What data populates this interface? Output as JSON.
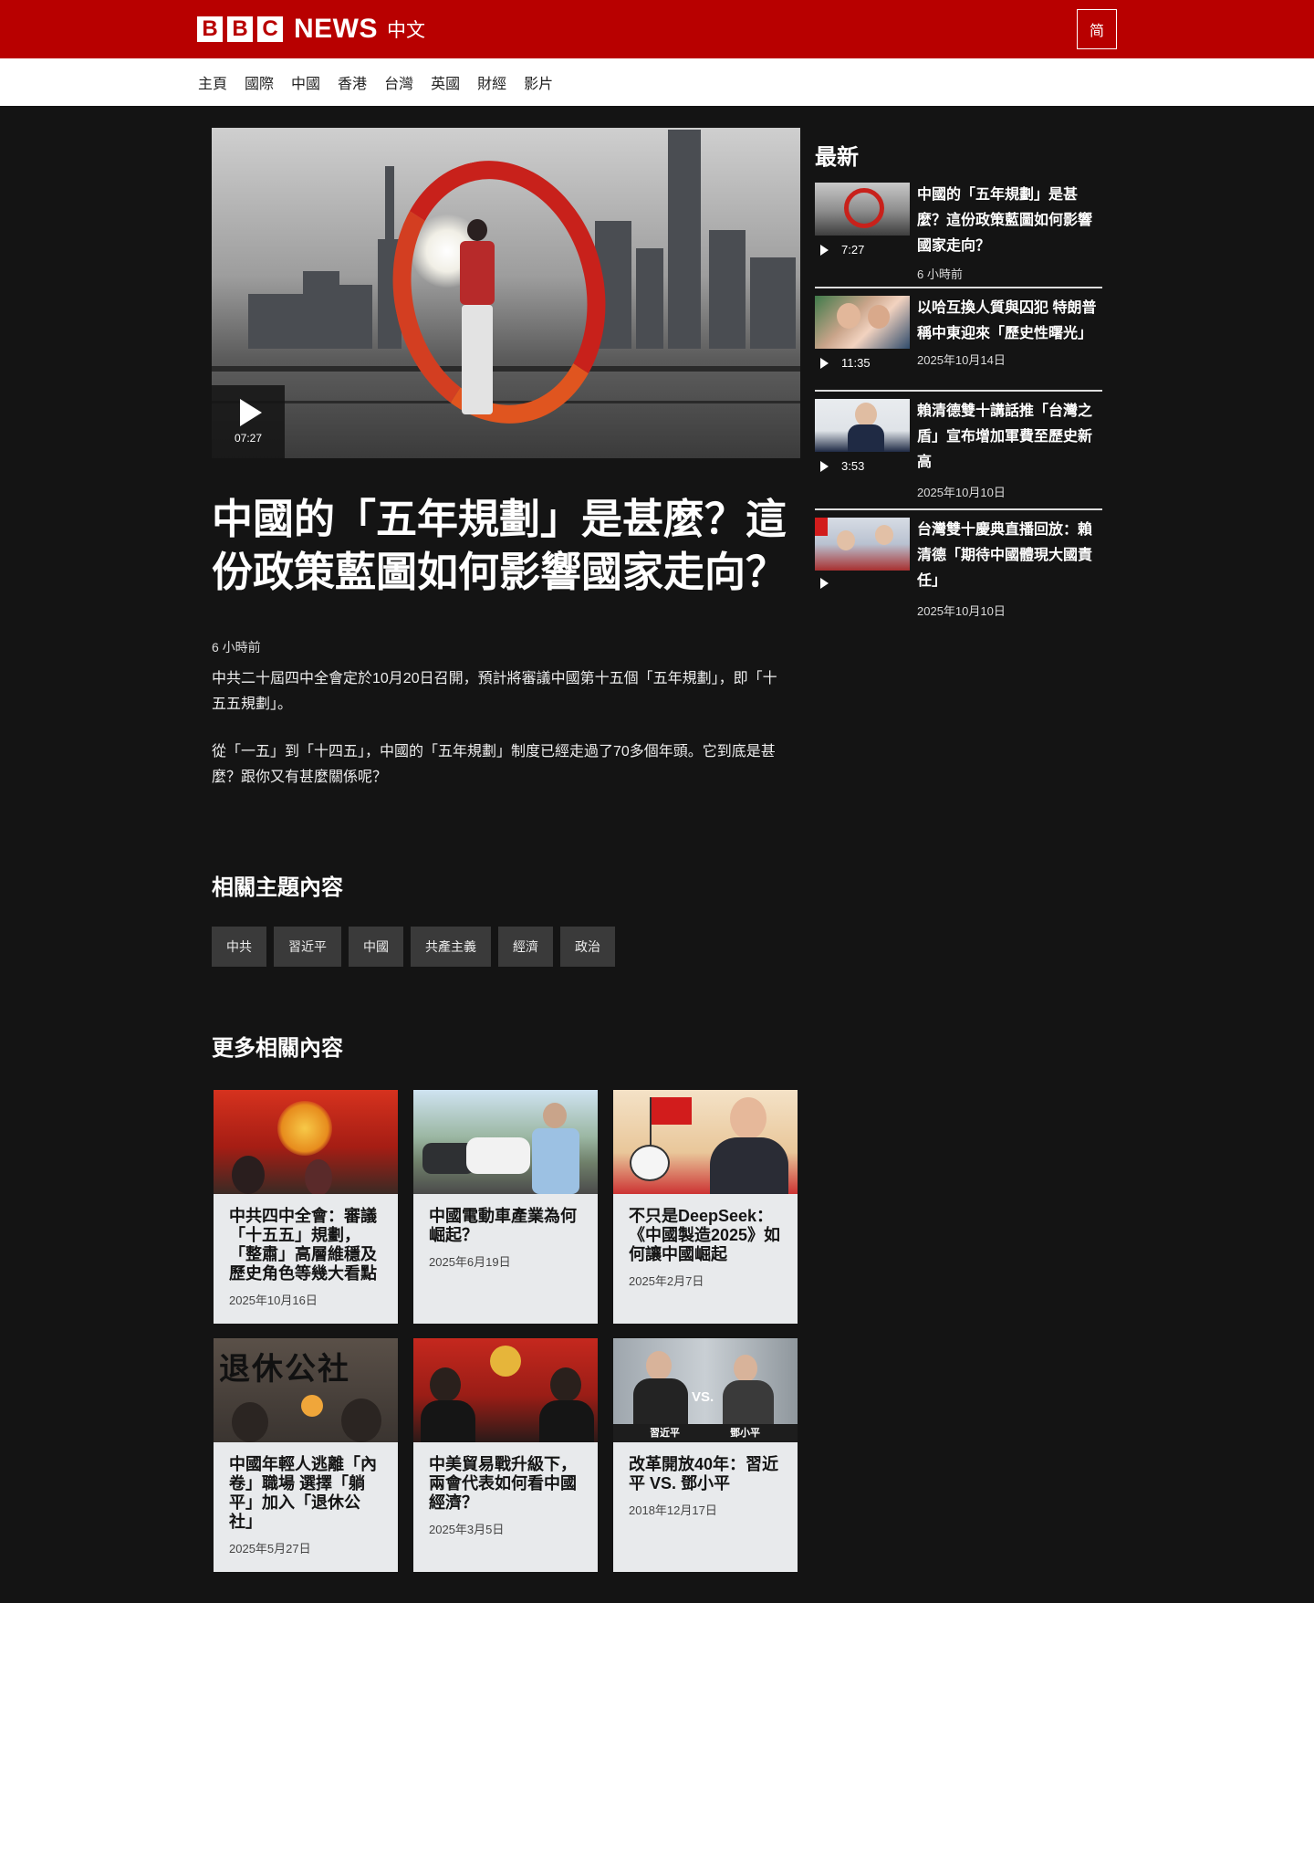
{
  "header": {
    "brand_letters": [
      "B",
      "B",
      "C"
    ],
    "brand_news": "NEWS",
    "brand_lang": "中文",
    "lang_toggle": "简"
  },
  "nav": {
    "items": [
      "主頁",
      "國際",
      "中國",
      "香港",
      "台灣",
      "英國",
      "財經",
      "影片"
    ]
  },
  "article": {
    "video_duration": "07:27",
    "headline": "中國的「五年規劃」是甚麼？這份政策藍圖如何影響國家走向？",
    "date": "6 小時前",
    "paragraphs": [
      "中共二十屆四中全會定於10月20日召開，預計將審議中國第十五個「五年規劃」，即「十五五規劃」。",
      "從「一五」到「十四五」，中國的「五年規劃」制度已經走過了70多個年頭。它到底是甚麼？跟你又有甚麼關係呢？"
    ]
  },
  "topics": {
    "title": "相關主題內容",
    "tags": [
      "中共",
      "習近平",
      "中國",
      "共產主義",
      "經濟",
      "政治"
    ]
  },
  "more": {
    "title": "更多相關內容",
    "cards": [
      {
        "title": "中共四中全會：審議「十五五」規劃，「整肅」高層維穩及歷史角色等幾大看點",
        "date": "2025年10月16日"
      },
      {
        "title": "中國電動車產業為何崛起？",
        "date": "2025年6月19日"
      },
      {
        "title": "不只是DeepSeek：《中國製造2025》如何讓中國崛起",
        "date": "2025年2月7日"
      },
      {
        "title": "中國年輕人逃離「內卷」職場 選擇「躺平」加入「退休公社」",
        "date": "2025年5月27日"
      },
      {
        "title": "中美貿易戰升級下，兩會代表如何看中國經濟？",
        "date": "2025年3月5日"
      },
      {
        "title": "改革開放40年：習近平 VS. 鄧小平",
        "date": "2018年12月17日"
      }
    ],
    "card_overlay_text": {
      "xi": "習近平",
      "deng": "鄧小平",
      "vs": "VS.",
      "calligraphy": "退休公社"
    }
  },
  "latest": {
    "title": "最新",
    "items": [
      {
        "title": "中國的「五年規劃」是甚麼？這份政策藍圖如何影響國家走向？",
        "duration": "7:27",
        "date": "6 小時前"
      },
      {
        "title": "以哈互換人質與囚犯 特朗普稱中東迎來「歷史性曙光」",
        "duration": "11:35",
        "date": "2025年10月14日"
      },
      {
        "title": "賴清德雙十講話推「台灣之盾」宣布增加軍費至歷史新高",
        "duration": "3:53",
        "date": "2025年10月10日"
      },
      {
        "title": "台灣雙十慶典直播回放：賴清德「期待中國體現大國責任」",
        "duration": "",
        "date": "2025年10月10日"
      }
    ]
  },
  "colors": {
    "brand_red": "#b80000",
    "page_dark": "#141414",
    "card_bg": "#e8eaec",
    "tag_bg": "#3a3a3a"
  }
}
